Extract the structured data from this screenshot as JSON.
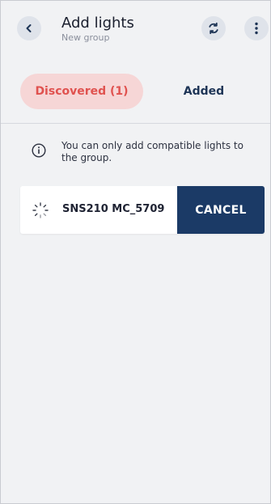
{
  "header": {
    "title": "Add lights",
    "subtitle": "New group",
    "back_icon": "chevron-left-icon",
    "sync_icon": "sync-icon",
    "more_icon": "more-vertical-icon"
  },
  "tabs": [
    {
      "label": "Discovered (1)",
      "selected": true
    },
    {
      "label": "Added",
      "selected": false
    }
  ],
  "info": {
    "icon": "info-icon",
    "text": "You can only add compatible lights to the group."
  },
  "device": {
    "name": "SNS210 MC_5709",
    "status_icon": "loading-spinner-icon",
    "cancel_label": "CANCEL"
  },
  "colors": {
    "accent": "#1b3a66",
    "selected_tab_bg": "#f6d6d6",
    "selected_tab_text": "#e0524f",
    "background": "#f1f2f4"
  }
}
